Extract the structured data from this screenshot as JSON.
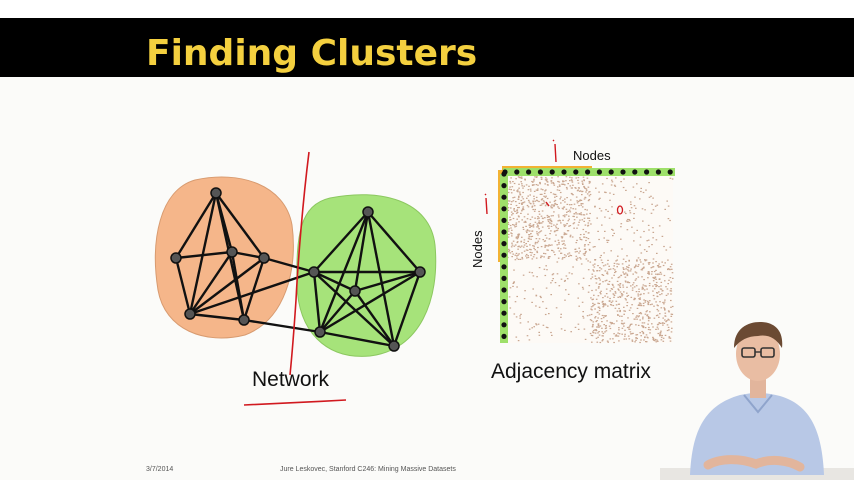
{
  "slide": {
    "title": "Finding Clusters",
    "footer_date": "3/7/2014",
    "footer_credit": "Jure Leskovec, Stanford C246: Mining Massive Datasets"
  },
  "network": {
    "label": "Network",
    "cluster_a_color": "#f5b68a",
    "cluster_b_color": "#a6e37a"
  },
  "matrix": {
    "label": "Adjacency matrix",
    "axis_top": "Nodes",
    "axis_side": "Nodes",
    "block_color": "#c9a68f"
  },
  "annotations": {
    "ink_color": "#d1191f"
  }
}
